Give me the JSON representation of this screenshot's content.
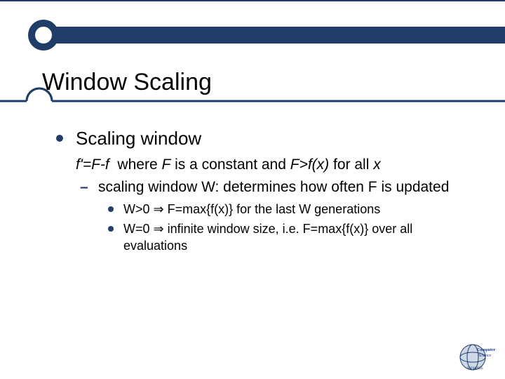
{
  "colors": {
    "accent": "#203d68"
  },
  "slide": {
    "title": "Window Scaling",
    "bullets": {
      "l1": "Scaling window",
      "formula_html": "<span class='italic'>f'=F-f</span>  where <span class='italic'>F</span> is a constant and <span class='italic'>F>f(x)</span> for all <span class='italic'>x</span>",
      "l2": "scaling window W: determines how often F is updated",
      "l3a": "W>0 ⇒ F=max{f(x)} for the last W generations",
      "l3b": "W=0 ⇒ infinite window size, i.e. F=max{f(x)} over all evaluations"
    }
  },
  "logo": {
    "alt": "Computer Science Memphis logo"
  }
}
